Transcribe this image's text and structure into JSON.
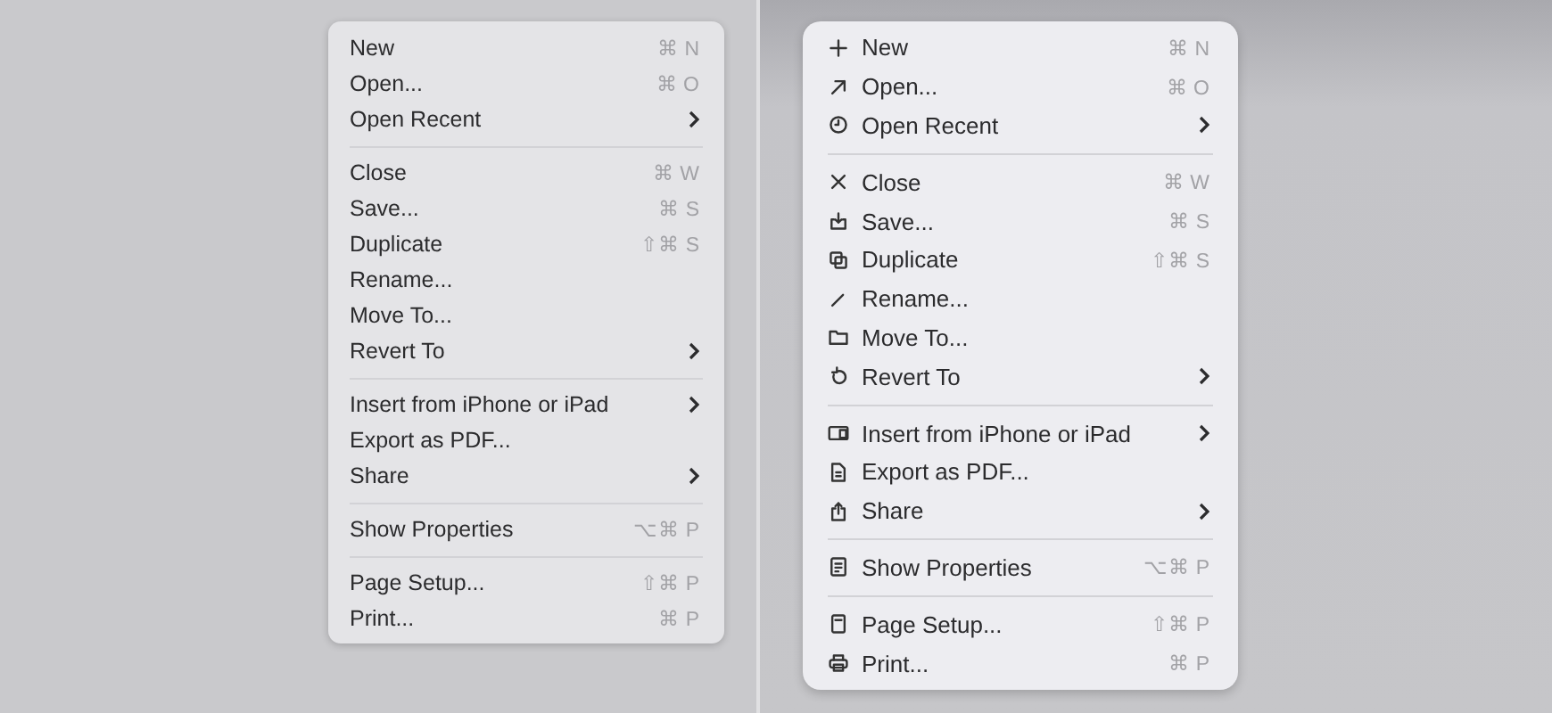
{
  "menus": [
    {
      "icons": false,
      "groups": [
        [
          {
            "label": "New",
            "shortcut": "⌘ N",
            "submenu": false
          },
          {
            "label": "Open...",
            "shortcut": "⌘ O",
            "submenu": false
          },
          {
            "label": "Open Recent",
            "submenu": true
          }
        ],
        [
          {
            "label": "Close",
            "shortcut": "⌘ W",
            "submenu": false
          },
          {
            "label": "Save...",
            "shortcut": "⌘ S",
            "submenu": false
          },
          {
            "label": "Duplicate",
            "shortcut": "⇧⌘ S",
            "submenu": false
          },
          {
            "label": "Rename...",
            "submenu": false
          },
          {
            "label": "Move To...",
            "submenu": false
          },
          {
            "label": "Revert To",
            "submenu": true
          }
        ],
        [
          {
            "label": "Insert from iPhone or iPad",
            "submenu": true
          },
          {
            "label": "Export as PDF...",
            "submenu": false
          },
          {
            "label": "Share",
            "submenu": true
          }
        ],
        [
          {
            "label": "Show Properties",
            "shortcut": "⌥⌘ P",
            "submenu": false
          }
        ],
        [
          {
            "label": "Page Setup...",
            "shortcut": "⇧⌘ P",
            "submenu": false
          },
          {
            "label": "Print...",
            "shortcut": "⌘ P",
            "submenu": false
          }
        ]
      ]
    },
    {
      "icons": true,
      "groups": [
        [
          {
            "label": "New",
            "shortcut": "⌘ N",
            "submenu": false
          },
          {
            "label": "Open...",
            "shortcut": "⌘ O",
            "submenu": false
          },
          {
            "label": "Open Recent",
            "submenu": true
          }
        ],
        [
          {
            "label": "Close",
            "shortcut": "⌘ W",
            "submenu": false
          },
          {
            "label": "Save...",
            "shortcut": "⌘ S",
            "submenu": false
          },
          {
            "label": "Duplicate",
            "shortcut": "⇧⌘ S",
            "submenu": false
          },
          {
            "label": "Rename...",
            "submenu": false
          },
          {
            "label": "Move To...",
            "submenu": false
          },
          {
            "label": "Revert To",
            "submenu": true
          }
        ],
        [
          {
            "label": "Insert from iPhone or iPad",
            "submenu": true
          },
          {
            "label": "Export as PDF...",
            "submenu": false
          },
          {
            "label": "Share",
            "submenu": true
          }
        ],
        [
          {
            "label": "Show Properties",
            "shortcut": "⌥⌘ P",
            "submenu": false
          }
        ],
        [
          {
            "label": "Page Setup...",
            "shortcut": "⇧⌘ P",
            "submenu": false
          },
          {
            "label": "Print...",
            "shortcut": "⌘ P",
            "submenu": false
          }
        ]
      ]
    }
  ]
}
